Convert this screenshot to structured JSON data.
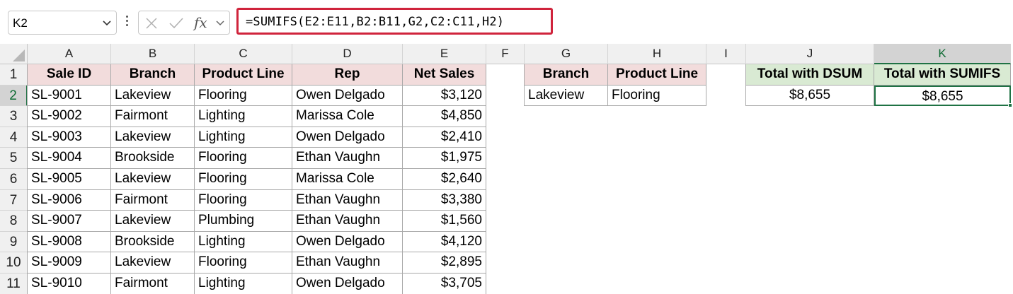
{
  "name_box": {
    "value": "K2"
  },
  "formula_bar": {
    "formula": "=SUMIFS(E2:E11,B2:B11,G2,C2:C11,H2)",
    "fx_label": "fx"
  },
  "columns": [
    "A",
    "B",
    "C",
    "D",
    "E",
    "F",
    "G",
    "H",
    "I",
    "J",
    "K"
  ],
  "rows": [
    "1",
    "2",
    "3",
    "4",
    "5",
    "6",
    "7",
    "8",
    "9",
    "10",
    "11"
  ],
  "table": {
    "headers": [
      "Sale ID",
      "Branch",
      "Product Line",
      "Rep",
      "Net Sales"
    ],
    "rows": [
      [
        "SL-9001",
        "Lakeview",
        "Flooring",
        "Owen Delgado",
        "$3,120"
      ],
      [
        "SL-9002",
        "Fairmont",
        "Lighting",
        "Marissa Cole",
        "$4,850"
      ],
      [
        "SL-9003",
        "Lakeview",
        "Lighting",
        "Owen Delgado",
        "$2,410"
      ],
      [
        "SL-9004",
        "Brookside",
        "Flooring",
        "Ethan Vaughn",
        "$1,975"
      ],
      [
        "SL-9005",
        "Lakeview",
        "Flooring",
        "Marissa Cole",
        "$2,640"
      ],
      [
        "SL-9006",
        "Fairmont",
        "Flooring",
        "Ethan Vaughn",
        "$3,380"
      ],
      [
        "SL-9007",
        "Lakeview",
        "Plumbing",
        "Ethan Vaughn",
        "$1,560"
      ],
      [
        "SL-9008",
        "Brookside",
        "Lighting",
        "Owen Delgado",
        "$4,120"
      ],
      [
        "SL-9009",
        "Lakeview",
        "Flooring",
        "Ethan Vaughn",
        "$2,895"
      ],
      [
        "SL-9010",
        "Fairmont",
        "Lighting",
        "Owen Delgado",
        "$3,705"
      ]
    ]
  },
  "criteria": {
    "headers": [
      "Branch",
      "Product Line"
    ],
    "values": [
      "Lakeview",
      "Flooring"
    ]
  },
  "results": {
    "headers": [
      "Total with DSUM",
      "Total with SUMIFS"
    ],
    "values": [
      "$8,655",
      "$8,655"
    ]
  },
  "colors": {
    "header_pink": "#f2dcdc",
    "header_green": "#d9ead3",
    "accent_green": "#1f7244",
    "formula_border": "#d0243c"
  }
}
